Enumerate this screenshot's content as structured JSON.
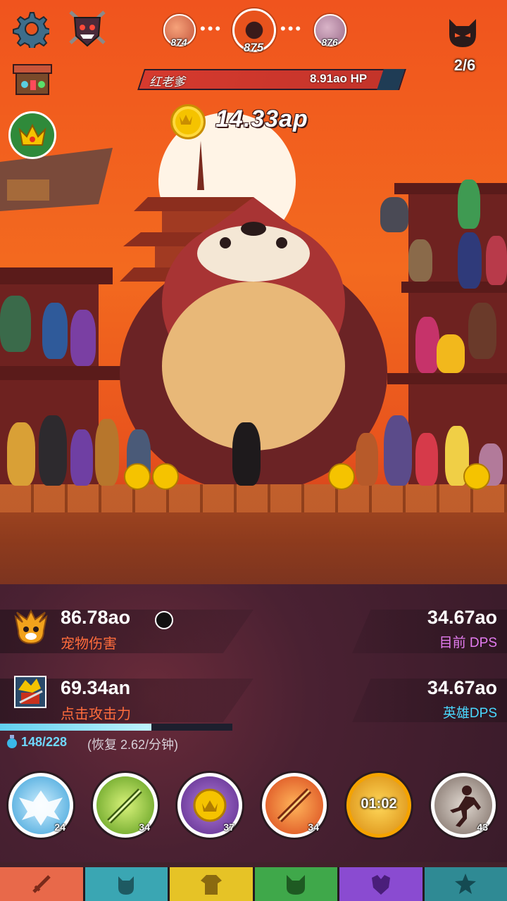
{
  "top": {
    "stages": [
      {
        "number": "874",
        "current": false
      },
      {
        "number": "875",
        "current": true
      },
      {
        "number": "876",
        "current": false
      }
    ],
    "boss_progress": "2/6",
    "icons": {
      "settings": "gear-icon",
      "clan": "demon-shield-icon",
      "boss": "devil-head-icon"
    }
  },
  "boss": {
    "name": "红老爹",
    "hp": "8.91ao HP"
  },
  "gold": {
    "amount": "14.33ap"
  },
  "stats": {
    "pet_damage": {
      "value": "86.78ao",
      "label": "宠物伤害"
    },
    "current_dps": {
      "value": "34.67ao",
      "label": "目前 DPS"
    },
    "tap_damage": {
      "value": "69.34an",
      "label": "点击攻击力"
    },
    "hero_dps": {
      "value": "34.67ao",
      "label": "英雄DPS"
    }
  },
  "mana": {
    "text": "148/228",
    "regen": "(恢复 2.62/分钟)",
    "fraction": 0.65
  },
  "skills": [
    {
      "name": "heavenly-strike",
      "level": "24"
    },
    {
      "name": "deadly-strike",
      "level": "34"
    },
    {
      "name": "hand-of-midas",
      "level": "37"
    },
    {
      "name": "fire-sword",
      "level": "34"
    },
    {
      "name": "war-cry",
      "level": "",
      "timer": "01:02"
    },
    {
      "name": "shadow-clone",
      "level": "43"
    }
  ],
  "tabs": [
    {
      "name": "sword",
      "color": "#e8694a"
    },
    {
      "name": "heroes",
      "color": "#3aa6b3"
    },
    {
      "name": "equipment",
      "color": "#e6c326"
    },
    {
      "name": "pets",
      "color": "#3fa84a"
    },
    {
      "name": "clan",
      "color": "#8a4bd1"
    },
    {
      "name": "artifacts",
      "color": "#2f8a94"
    }
  ]
}
